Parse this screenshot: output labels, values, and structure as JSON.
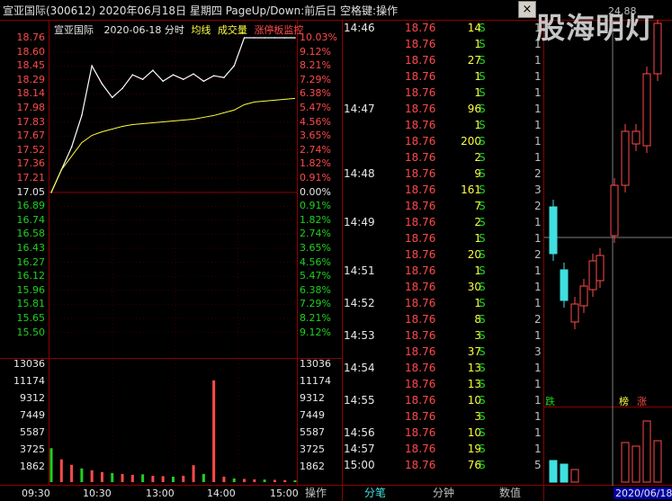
{
  "window": {
    "title": "宣亚国际(300612)  2020年06月18日 星期四 PageUp/Down:前后日 空格键:操作",
    "close_label": "×"
  },
  "chart_header": {
    "name": "宣亚国际",
    "datetime": "2020-06-18 分时",
    "legend_avg": "均线",
    "legend_vol": "成交量",
    "legend_limit": "涨停板监控"
  },
  "price_axis": {
    "left": [
      "18.76",
      "18.60",
      "18.45",
      "18.29",
      "18.14",
      "17.98",
      "17.83",
      "17.67",
      "17.52",
      "17.36",
      "17.21",
      "17.05",
      "16.89",
      "16.74",
      "16.58",
      "16.43",
      "16.27",
      "16.12",
      "15.96",
      "15.81",
      "15.65",
      "15.50"
    ],
    "right": [
      "10.03%",
      "9.12%",
      "8.21%",
      "7.29%",
      "6.38%",
      "5.47%",
      "4.56%",
      "3.65%",
      "2.74%",
      "1.82%",
      "0.91%",
      "0.00%",
      "0.91%",
      "1.82%",
      "2.74%",
      "3.65%",
      "4.56%",
      "5.47%",
      "6.38%",
      "7.29%",
      "8.21%",
      "9.12%"
    ]
  },
  "volume_axis": {
    "left": [
      "13036",
      "11174",
      "9312",
      "7449",
      "5587",
      "3725",
      "1862"
    ],
    "right": [
      "13036",
      "11174",
      "9312",
      "7449",
      "5587",
      "3725",
      "1862"
    ]
  },
  "time_axis": [
    "09:30",
    "10:30",
    "13:00",
    "14:00",
    "15:00"
  ],
  "chart_data": {
    "type": "line",
    "x_label": "",
    "y_label": "",
    "ylim": [
      15.5,
      18.76
    ],
    "prev_close": 17.05,
    "series": [
      {
        "name": "均线",
        "values": [
          17.05,
          17.3,
          17.45,
          17.6,
          17.68,
          17.72,
          17.75,
          17.78,
          17.8,
          17.81,
          17.82,
          17.83,
          17.84,
          17.85,
          17.86,
          17.88,
          17.9,
          17.93,
          17.96,
          18.02,
          18.05,
          18.06,
          18.07,
          18.08,
          18.09
        ]
      }
    ],
    "price_values": [
      17.05,
      17.3,
      17.55,
      17.9,
      18.45,
      18.25,
      18.1,
      18.2,
      18.35,
      18.3,
      18.4,
      18.28,
      18.35,
      18.3,
      18.36,
      18.28,
      18.34,
      18.32,
      18.45,
      18.76,
      18.76,
      18.76,
      18.76,
      18.76,
      18.76
    ],
    "volume_values": [
      3725,
      2500,
      1900,
      1500,
      1300,
      1100,
      1000,
      900,
      800,
      850,
      700,
      650,
      600,
      700,
      1862,
      900,
      11174,
      600,
      400,
      350,
      300,
      280,
      250,
      220,
      200
    ]
  },
  "ticks": [
    {
      "time": "14:46",
      "price": "18.76",
      "vol": "14",
      "side": "S",
      "n": "1"
    },
    {
      "time": "",
      "price": "18.76",
      "vol": "1",
      "side": "S",
      "n": "1"
    },
    {
      "time": "",
      "price": "18.76",
      "vol": "27",
      "side": "S",
      "n": "1"
    },
    {
      "time": "",
      "price": "18.76",
      "vol": "1",
      "side": "S",
      "n": "1"
    },
    {
      "time": "",
      "price": "18.76",
      "vol": "1",
      "side": "S",
      "n": "1"
    },
    {
      "time": "14:47",
      "price": "18.76",
      "vol": "96",
      "side": "S",
      "n": "1"
    },
    {
      "time": "",
      "price": "18.76",
      "vol": "1",
      "side": "S",
      "n": "1"
    },
    {
      "time": "",
      "price": "18.76",
      "vol": "200",
      "side": "S",
      "n": "1"
    },
    {
      "time": "",
      "price": "18.76",
      "vol": "2",
      "side": "S",
      "n": "1"
    },
    {
      "time": "14:48",
      "price": "18.76",
      "vol": "9",
      "side": "S",
      "n": "2"
    },
    {
      "time": "",
      "price": "18.76",
      "vol": "161",
      "side": "S",
      "n": "3"
    },
    {
      "time": "",
      "price": "18.76",
      "vol": "7",
      "side": "S",
      "n": "2"
    },
    {
      "time": "14:49",
      "price": "18.76",
      "vol": "2",
      "side": "S",
      "n": "1"
    },
    {
      "time": "",
      "price": "18.76",
      "vol": "1",
      "side": "S",
      "n": "1"
    },
    {
      "time": "",
      "price": "18.76",
      "vol": "20",
      "side": "S",
      "n": "2"
    },
    {
      "time": "14:51",
      "price": "18.76",
      "vol": "1",
      "side": "S",
      "n": "1"
    },
    {
      "time": "",
      "price": "18.76",
      "vol": "30",
      "side": "S",
      "n": "1"
    },
    {
      "time": "14:52",
      "price": "18.76",
      "vol": "1",
      "side": "S",
      "n": "1"
    },
    {
      "time": "",
      "price": "18.76",
      "vol": "8",
      "side": "S",
      "n": "2"
    },
    {
      "time": "14:53",
      "price": "18.76",
      "vol": "3",
      "side": "S",
      "n": "1"
    },
    {
      "time": "",
      "price": "18.76",
      "vol": "37",
      "side": "S",
      "n": "3"
    },
    {
      "time": "14:54",
      "price": "18.76",
      "vol": "13",
      "side": "S",
      "n": "1"
    },
    {
      "time": "",
      "price": "18.76",
      "vol": "13",
      "side": "S",
      "n": "1"
    },
    {
      "time": "14:55",
      "price": "18.76",
      "vol": "10",
      "side": "S",
      "n": "1"
    },
    {
      "time": "",
      "price": "18.76",
      "vol": "3",
      "side": "S",
      "n": "1"
    },
    {
      "time": "14:56",
      "price": "18.76",
      "vol": "10",
      "side": "S",
      "n": "1"
    },
    {
      "time": "14:57",
      "price": "18.76",
      "vol": "19",
      "side": "S",
      "n": "1"
    },
    {
      "time": "15:00",
      "price": "18.76",
      "vol": "76",
      "side": "S",
      "n": "5"
    }
  ],
  "bottom_tabs": {
    "op": "操作",
    "ticks": "分笔",
    "minute": "分钟",
    "value": "数值"
  },
  "kline": {
    "top_value": "24.88",
    "label_fall": "跌",
    "label_rank": "榜",
    "label_rise": "涨",
    "date": "2020/06/18",
    "watermark": "股海明灯"
  },
  "colors": {
    "up": "#ff4a4a",
    "down": "#40e0e0",
    "avg": "#ffff40",
    "bg": "#000000",
    "grid": "#8b0000"
  }
}
